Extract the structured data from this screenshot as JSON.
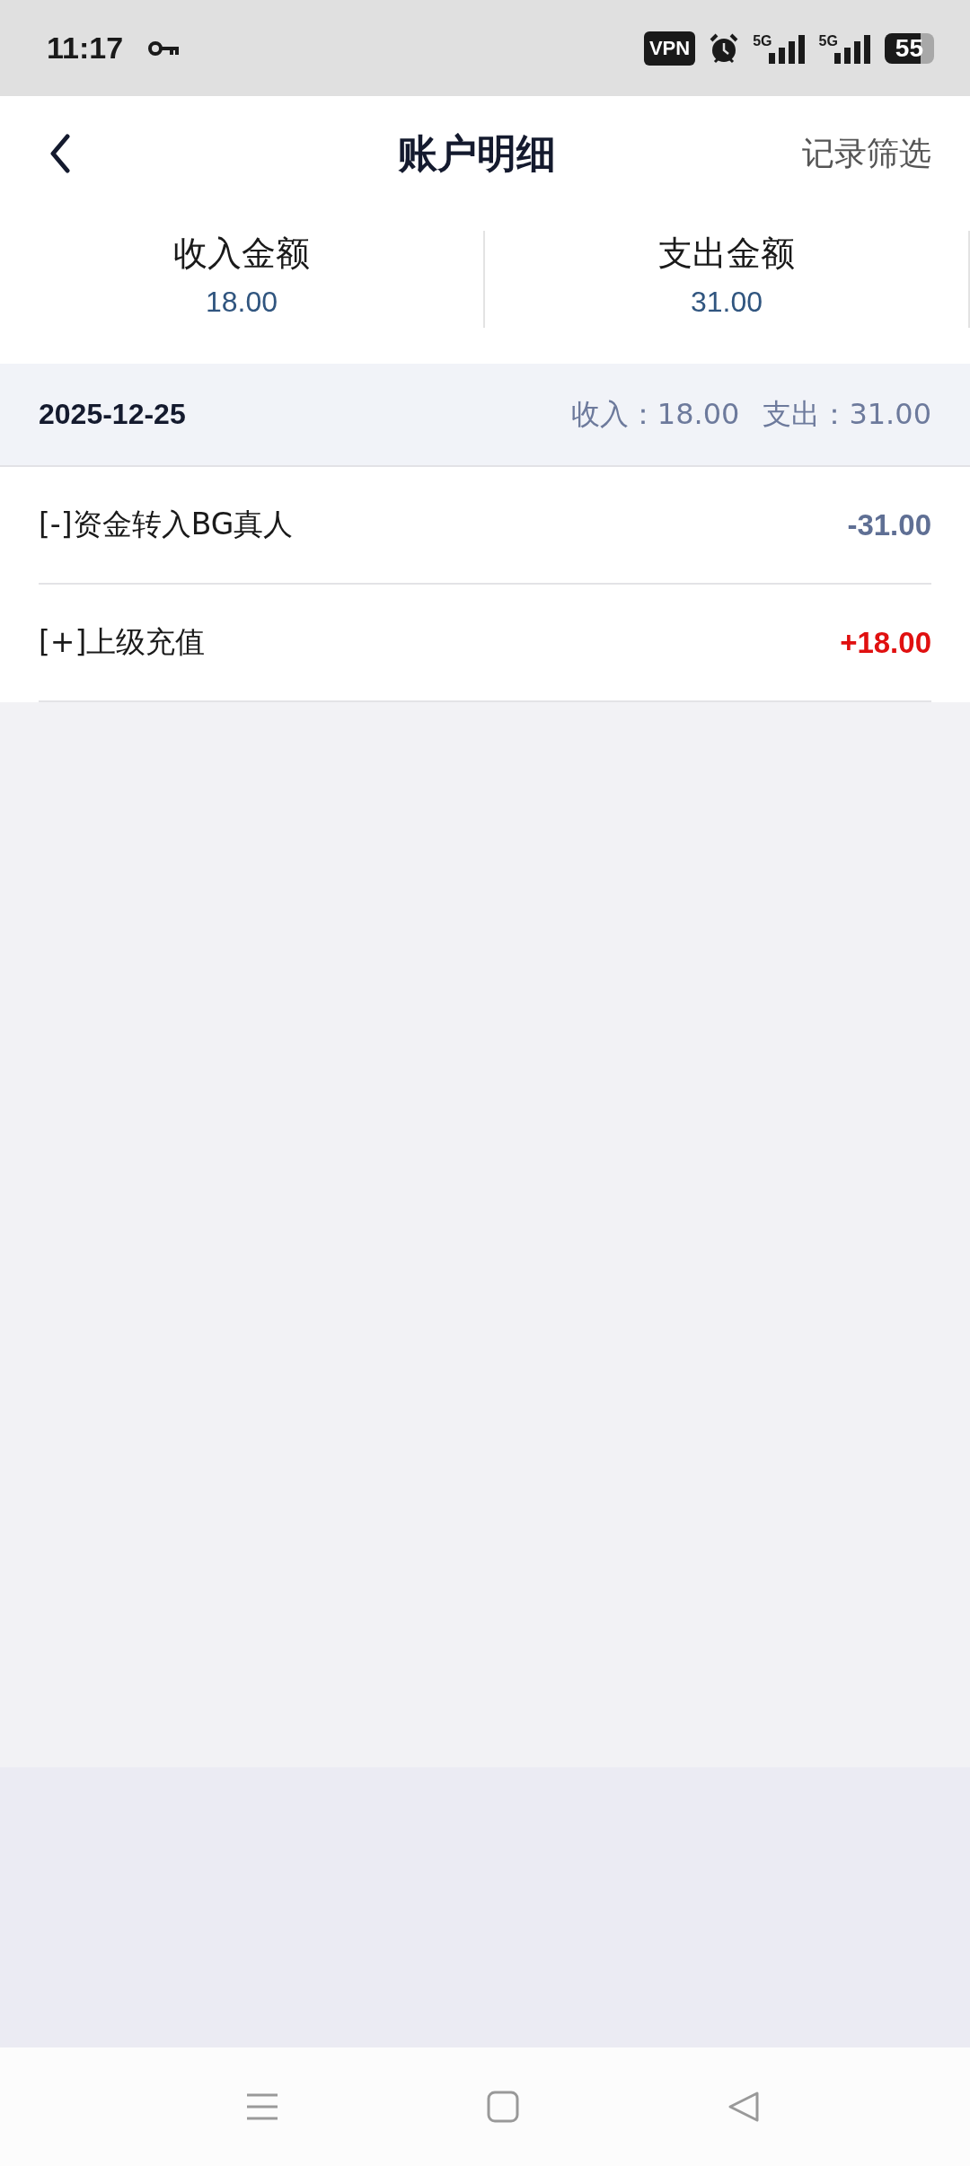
{
  "status_bar": {
    "time": "11:17",
    "vpn": "VPN",
    "networks": [
      "5G",
      "5G"
    ],
    "battery": "55"
  },
  "header": {
    "title": "账户明细",
    "action": "记录筛选"
  },
  "summary": [
    {
      "label": "收入金额",
      "value": "18.00"
    },
    {
      "label": "支出金额",
      "value": "31.00"
    }
  ],
  "groups": [
    {
      "date": "2025-12-25",
      "income": "收入：18.00",
      "expense": "支出：31.00",
      "rows": [
        {
          "title": "[-]资金转入BG真人",
          "amount": "-31.00",
          "kind": "expense"
        },
        {
          "title": "[+]上级充值",
          "amount": "+18.00",
          "kind": "income"
        }
      ]
    }
  ]
}
